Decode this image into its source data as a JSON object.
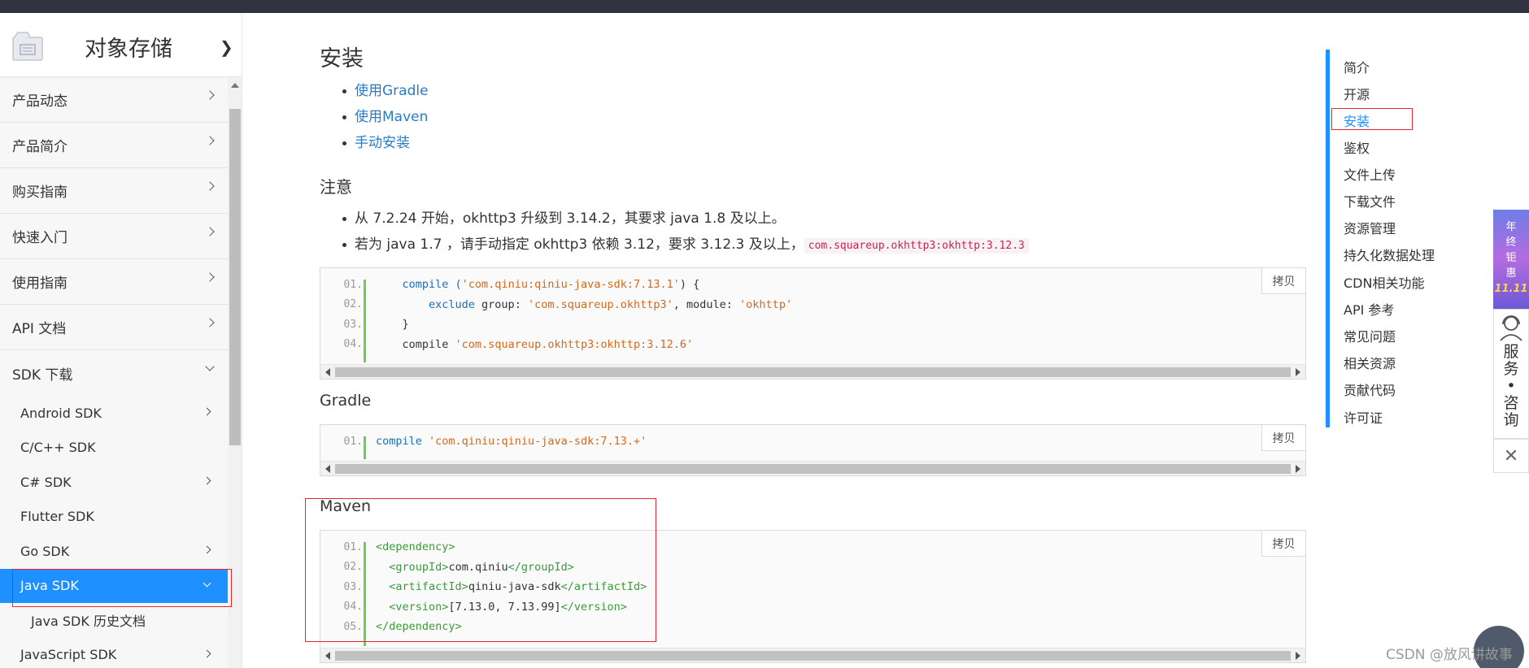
{
  "sidebar": {
    "title": "对象存储",
    "menu": [
      {
        "label": "产品动态"
      },
      {
        "label": "产品简介"
      },
      {
        "label": "购买指南"
      },
      {
        "label": "快速入门"
      },
      {
        "label": "使用指南"
      },
      {
        "label": "API 文档"
      },
      {
        "label": "SDK 下载"
      }
    ],
    "sdk_items": [
      {
        "label": "Android SDK"
      },
      {
        "label": "C/C++ SDK"
      },
      {
        "label": "C# SDK"
      },
      {
        "label": "Flutter SDK"
      },
      {
        "label": "Go SDK"
      },
      {
        "label": "Java SDK"
      },
      {
        "label": "Java SDK 历史文档"
      },
      {
        "label": "JavaScript SDK"
      }
    ]
  },
  "main": {
    "install_title": "安装",
    "install_links": [
      "使用Gradle",
      "使用Maven",
      "手动安装"
    ],
    "notice_title": "注意",
    "notice_items": {
      "first": "从 7.2.24 开始，okhttp3 升级到 3.14.2，其要求 java 1.8 及以上。",
      "second": "若为 java 1.7 ，请手动指定 okhttp3 依赖 3.12，要求 3.12.3 及以上，",
      "second_code": "com.squareup.okhttp3:okhttp:3.12.3"
    },
    "copy_label": "拷贝",
    "code1": {
      "line_numbers": [
        "01.",
        "02.",
        "03.",
        "04."
      ],
      "l1_a": "    compile (",
      "l1_b": "'com.qiniu:qiniu-java-sdk:7.13.1'",
      "l1_c": ") {",
      "l2_a": "        exclude",
      "l2_b": " group: ",
      "l2_c": "'com.squareup.okhttp3'",
      "l2_d": ", module: ",
      "l2_e": "'okhttp'",
      "l3": "    }",
      "l4_a": "    compile ",
      "l4_b": "'com.squareup.okhttp3:okhttp:3.12.6'"
    },
    "gradle_title": "Gradle",
    "code2": {
      "line_numbers": [
        "01."
      ],
      "l1_a": "compile",
      "l1_b": " 'com.qiniu:qiniu-java-sdk:7.13.+'"
    },
    "maven_title": "Maven",
    "code3": {
      "line_numbers": [
        "01.",
        "02.",
        "03.",
        "04.",
        "05."
      ],
      "lines": [
        {
          "o": "<",
          "t": "dependency",
          "c": ">",
          "v": "",
          "o2": "",
          "t2": "",
          "c2": ""
        },
        {
          "o": "  <",
          "t": "groupId",
          "c": ">",
          "v": "com.qiniu",
          "o2": "</",
          "t2": "groupId",
          "c2": ">"
        },
        {
          "o": "  <",
          "t": "artifactId",
          "c": ">",
          "v": "qiniu-java-sdk",
          "o2": "</",
          "t2": "artifactId",
          "c2": ">"
        },
        {
          "o": "  <",
          "t": "version",
          "c": ">",
          "v": "[7.13.0, 7.13.99]",
          "o2": "</",
          "t2": "version",
          "c2": ">"
        },
        {
          "o": "</",
          "t": "dependency",
          "c": ">",
          "v": "",
          "o2": "",
          "t2": "",
          "c2": ""
        }
      ]
    }
  },
  "toc": {
    "items": [
      "简介",
      "开源",
      "安装",
      "鉴权",
      "文件上传",
      "下载文件",
      "资源管理",
      "持久化数据处理",
      "CDN相关功能",
      "API 参考",
      "常见问题",
      "相关资源",
      "贡献代码",
      "许可证"
    ],
    "active": "安装"
  },
  "float": {
    "promo": [
      "年",
      "终",
      "钜",
      "惠",
      "11.11"
    ],
    "service": [
      "服",
      "务",
      "•",
      "咨",
      "询"
    ]
  },
  "watermark": "CSDN @放风讲故事",
  "colors": {
    "accent": "#1e90ff",
    "highlight": "#e6262f",
    "code_bar": "#6ccf4f"
  }
}
